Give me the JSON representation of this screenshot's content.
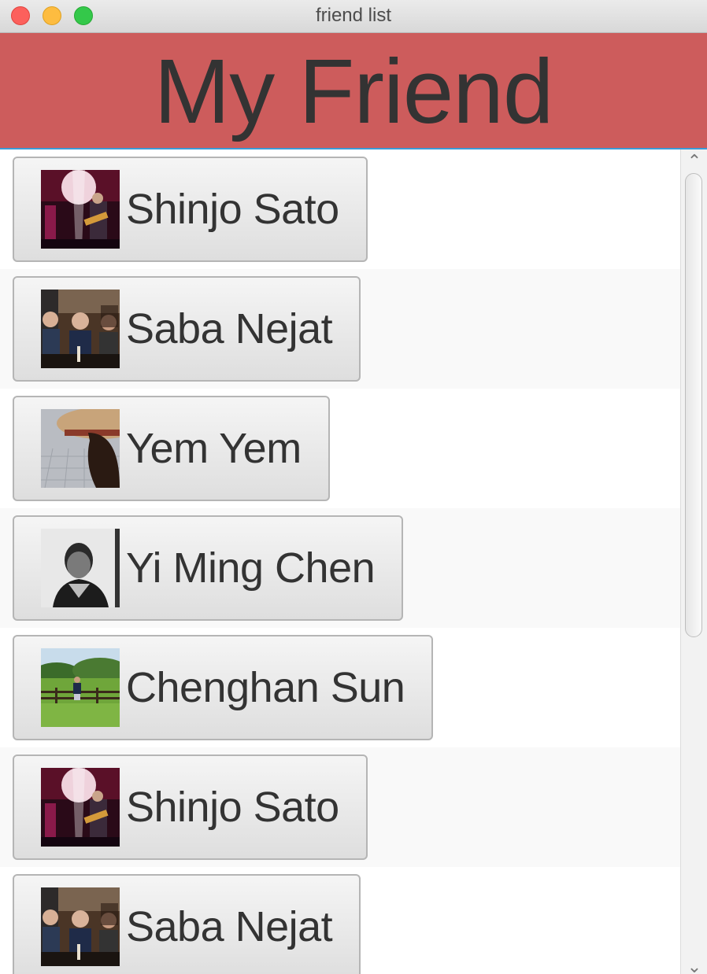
{
  "window": {
    "title": "friend list"
  },
  "header": {
    "title": "My Friend",
    "background": "#cd5c5c"
  },
  "friends": [
    {
      "name": "Shinjo Sato",
      "photo": "concert-guitar-photo"
    },
    {
      "name": "Saba Nejat",
      "photo": "group-dinner-photo"
    },
    {
      "name": "Yem Yem",
      "photo": "straw-hat-photo"
    },
    {
      "name": "Yi Ming Chen",
      "photo": "black-white-portrait-photo"
    },
    {
      "name": "Chenghan Sun",
      "photo": "field-fence-photo"
    },
    {
      "name": "Shinjo Sato",
      "photo": "concert-guitar-photo"
    },
    {
      "name": "Saba Nejat",
      "photo": "group-dinner-photo"
    }
  ],
  "scrollbar": {
    "up_icon": "chevron-up-icon",
    "down_icon": "chevron-down-icon",
    "position": 0
  }
}
